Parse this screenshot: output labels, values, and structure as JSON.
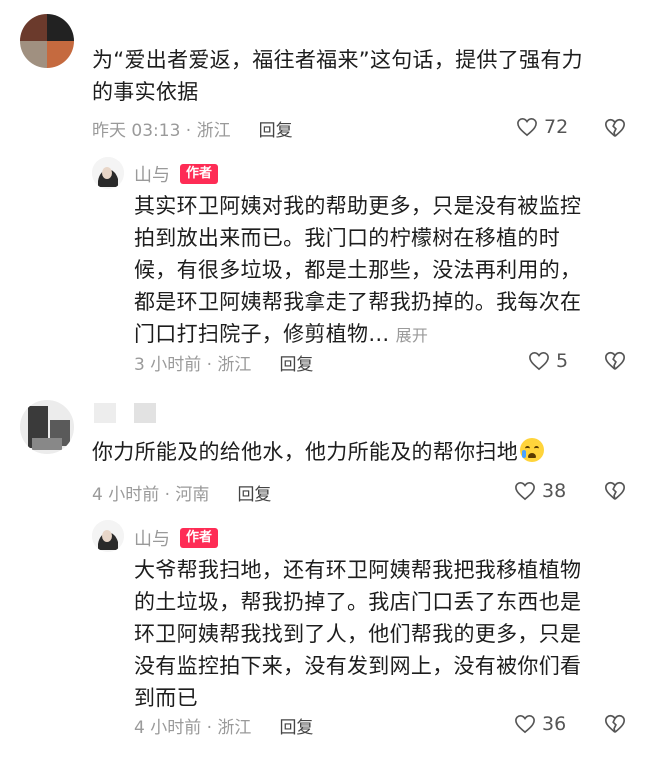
{
  "comments": [
    {
      "text_lines": [
        "为“爱出者爱返，福往者福来”这句话，提供了强有力",
        "的事实依据"
      ],
      "meta": "昨天 03:13 · 浙江",
      "reply_label": "回复",
      "likes": "72"
    },
    {
      "author": "山与",
      "tag": "作者",
      "text_lines": [
        "其实环卫阿姨对我的帮助更多，只是没有被监控",
        "拍到放出来而已。我门口的柠檬树在移植的时",
        "候，有很多垃圾，都是土那些，没法再利用的，",
        "都是环卫阿姨帮我拿走了帮我扔掉的。我每次在",
        "门口打扫院子，修剪植物…"
      ],
      "expand_label": "展开",
      "meta": "3 小时前 · 浙江",
      "reply_label": "回复",
      "likes": "5"
    },
    {
      "text_lines": [
        "你力所能及的给他水，他力所能及的帮你扫地"
      ],
      "emoji": "loudly-crying-face",
      "meta": "4 小时前 · 河南",
      "reply_label": "回复",
      "likes": "38"
    },
    {
      "author": "山与",
      "tag": "作者",
      "text_lines": [
        "大爷帮我扫地，还有环卫阿姨帮我把我移植植物",
        "的土垃圾，帮我扔掉了。我店门口丢了东西也是",
        "环卫阿姨帮我找到了人，他们帮我的更多，只是",
        "没有监控拍下来，没有发到网上，没有被你们看",
        "到而已"
      ],
      "meta": "4 小时前 · 浙江",
      "reply_label": "回复",
      "likes": "36"
    }
  ],
  "colors": {
    "tag": "#fe2c55",
    "meta": "#9a9a9a",
    "text": "#1d1d1d"
  }
}
